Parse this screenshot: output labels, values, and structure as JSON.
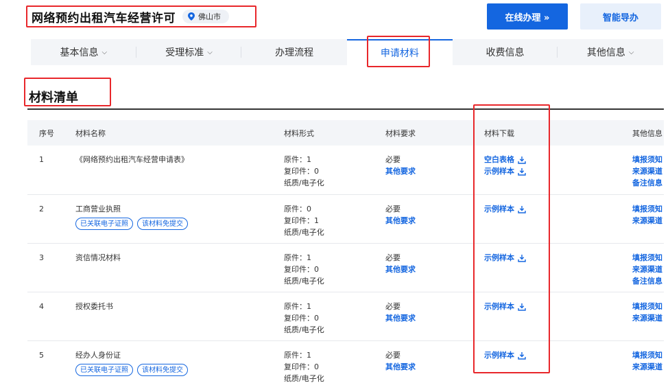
{
  "header": {
    "title": "网络预约出租汽车经营许可",
    "city": "佛山市",
    "online_btn": "在线办理 »",
    "guide_btn": "智能导办"
  },
  "tabs": [
    {
      "label": "基本信息",
      "chevron": true
    },
    {
      "label": "受理标准",
      "chevron": true
    },
    {
      "label": "办理流程",
      "chevron": false
    },
    {
      "label": "申请材料",
      "chevron": false,
      "active": true
    },
    {
      "label": "收费信息",
      "chevron": false
    },
    {
      "label": "其他信息",
      "chevron": true
    }
  ],
  "section": {
    "title": "材料清单"
  },
  "table": {
    "headers": {
      "no": "序号",
      "name": "材料名称",
      "form": "材料形式",
      "req": "材料要求",
      "download": "材料下载",
      "other": "其他信息"
    },
    "rows": [
      {
        "no": "1",
        "name": "《网络预约出租汽车经营申请表》",
        "tags": [],
        "form": [
          "原件：1",
          "复印件：0",
          "纸质/电子化"
        ],
        "req": "必要",
        "req_link": "其他要求",
        "downloads": [
          "空白表格",
          "示例样本"
        ],
        "other": [
          "填报须知",
          "来源渠道",
          "备注信息"
        ]
      },
      {
        "no": "2",
        "name": "工商营业执照",
        "tags": [
          "已关联电子证照",
          "该材料免提交"
        ],
        "form": [
          "原件：0",
          "复印件：1",
          "纸质/电子化"
        ],
        "req": "必要",
        "req_link": "其他要求",
        "downloads": [
          "示例样本"
        ],
        "other": [
          "填报须知",
          "来源渠道"
        ]
      },
      {
        "no": "3",
        "name": "资信情况材料",
        "tags": [],
        "form": [
          "原件：1",
          "复印件：0",
          "纸质/电子化"
        ],
        "req": "必要",
        "req_link": "其他要求",
        "downloads": [
          "示例样本"
        ],
        "other": [
          "填报须知",
          "来源渠道",
          "备注信息"
        ]
      },
      {
        "no": "4",
        "name": "授权委托书",
        "tags": [],
        "form": [
          "原件：1",
          "复印件：0",
          "纸质/电子化"
        ],
        "req": "必要",
        "req_link": "其他要求",
        "downloads": [
          "示例样本"
        ],
        "other": [
          "填报须知",
          "来源渠道"
        ]
      },
      {
        "no": "5",
        "name": "经办人身份证",
        "tags": [
          "已关联电子证照",
          "该材料免提交"
        ],
        "form": [
          "原件：1",
          "复印件：0",
          "纸质/电子化"
        ],
        "req": "必要",
        "req_link": "其他要求",
        "downloads": [
          "示例样本"
        ],
        "other": [
          "填报须知",
          "来源渠道"
        ]
      }
    ]
  },
  "colors": {
    "accent": "#1466e0",
    "highlight": "#e8262a"
  }
}
